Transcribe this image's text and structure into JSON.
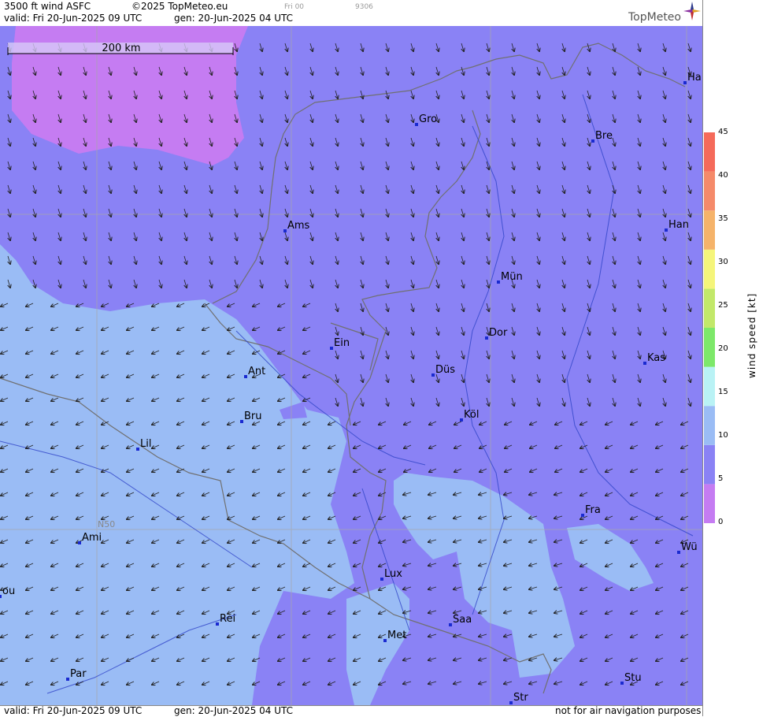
{
  "header": {
    "product": "3500 ft wind ASFC",
    "copyright": "©2025 TopMeteo.eu",
    "small_day": "Fri 00",
    "small_code": "9306",
    "valid": "valid:  Fri  20-Jun-2025  09 UTC",
    "generated": "gen: 20-Jun-2025 04 UTC",
    "brand": "TopMeteo"
  },
  "footer": {
    "valid": "valid:  Fri  20-Jun-2025  09 UTC",
    "generated": "gen: 20-Jun-2025 04 UTC",
    "disclaimer": "not for air navigation purposes"
  },
  "scale_bar": {
    "label": "200 km"
  },
  "grid_label": "N50",
  "legend": {
    "title": "wind  speed  [kt]",
    "ticks": [
      "0",
      "5",
      "10",
      "15",
      "20",
      "25",
      "30",
      "35",
      "40",
      "45"
    ],
    "colors": [
      "#c57cf2",
      "#8a82f5",
      "#9abcf5",
      "#b9f2f5",
      "#7de86a",
      "#c2e86a",
      "#f5f57a",
      "#f5b36a",
      "#f58a6a",
      "#f56a5a"
    ]
  },
  "cities": [
    {
      "name": "Gro"
    },
    {
      "name": "Bre"
    },
    {
      "name": "Ha"
    },
    {
      "name": "Ams"
    },
    {
      "name": "Han"
    },
    {
      "name": "Mün"
    },
    {
      "name": "Ein"
    },
    {
      "name": "Dor"
    },
    {
      "name": "Kas"
    },
    {
      "name": "Ant"
    },
    {
      "name": "Düs"
    },
    {
      "name": "Bru"
    },
    {
      "name": "Köl"
    },
    {
      "name": "Lil"
    },
    {
      "name": "Fra"
    },
    {
      "name": "Ami"
    },
    {
      "name": "Wü"
    },
    {
      "name": "Lux"
    },
    {
      "name": "ou"
    },
    {
      "name": "Rei"
    },
    {
      "name": "Saa"
    },
    {
      "name": "Met"
    },
    {
      "name": "Par"
    },
    {
      "name": "Stu"
    },
    {
      "name": "Str"
    }
  ]
}
